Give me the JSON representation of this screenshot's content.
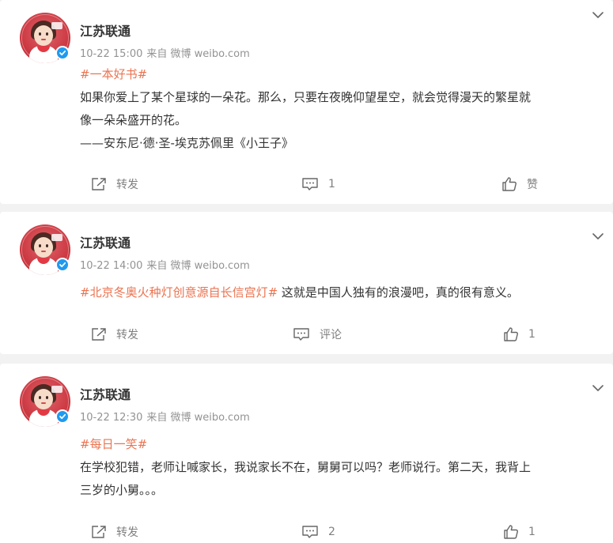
{
  "posts": [
    {
      "author": "江苏联通",
      "time": "10-22 15:00",
      "source": "来自 微博 weibo.com",
      "topic": "#一本好书#",
      "text_after_topic": "",
      "lines": [
        "如果你爱上了某个星球的一朵花。那么，只要在夜晚仰望星空，就会觉得漫天的繁星就",
        "像一朵朵盛开的花。",
        "——安东尼·德·圣-埃克苏佩里《小王子》"
      ],
      "actions": {
        "repost": "转发",
        "comment": "1",
        "like": "赞"
      }
    },
    {
      "author": "江苏联通",
      "time": "10-22 14:00",
      "source": "来自 微博 weibo.com",
      "topic": "#北京冬奥火种灯创意源自长信宫灯#",
      "text_after_topic": " 这就是中国人独有的浪漫吧，真的很有意义。",
      "lines": [],
      "actions": {
        "repost": "转发",
        "comment": "评论",
        "like": "1"
      }
    },
    {
      "author": "江苏联通",
      "time": "10-22 12:30",
      "source": "来自 微博 weibo.com",
      "topic": "#每日一笑#",
      "text_after_topic": "",
      "lines": [
        "在学校犯错，老师让喊家长，我说家长不在，舅舅可以吗？老师说行。第二天，我背上",
        "三岁的小舅。。。"
      ],
      "actions": {
        "repost": "转发",
        "comment": "2",
        "like": "1"
      }
    }
  ],
  "icons": {
    "avatar": "unicom-mascot-avatar",
    "verified": "verified-badge-icon",
    "more": "chevron-down-icon",
    "repost": "share-icon",
    "comment": "comment-icon",
    "like": "thumbs-up-icon"
  },
  "colors": {
    "topic": "#eb7350",
    "verified": "#1f9af0",
    "meta": "#939393",
    "background": "#f2f2f2"
  }
}
